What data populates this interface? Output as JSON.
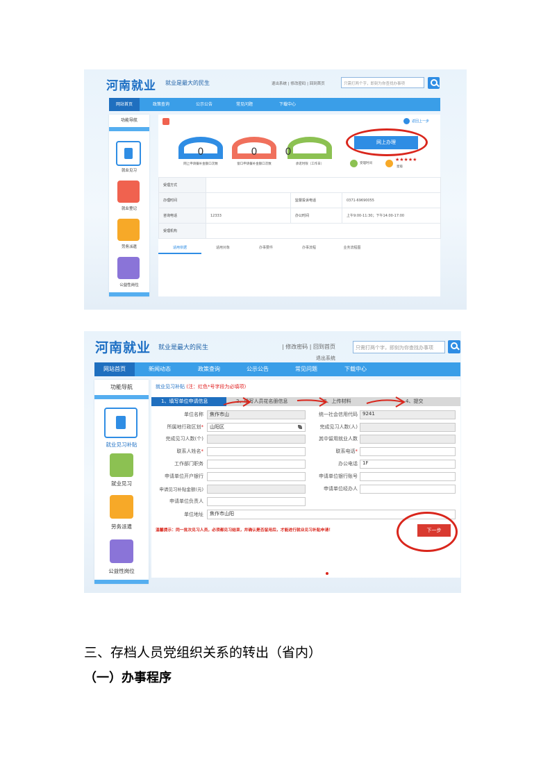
{
  "shot1": {
    "logo": "河南就业",
    "slogan": "就业是最大的民生",
    "top_links": "退出系统 | 修改密码 | 回到首页",
    "search_placeholder": "只需打两个字，即刻为你查找办事项",
    "nav": [
      "网站首页",
      "政策查询",
      "公示公告",
      "常见问题",
      "下载中心"
    ],
    "side_title": "功能导航",
    "side_items": [
      {
        "label": "就业见习",
        "color": "#2f8de4",
        "icon": "notebook-icon"
      },
      {
        "label": "就业登记",
        "color": "#f0624f",
        "icon": "calendar-icon"
      },
      {
        "label": "劳务派遣",
        "color": "#f7a928",
        "icon": "car-icon"
      },
      {
        "label": "公益性岗位",
        "color": "#8a74d8",
        "icon": "card-icon"
      }
    ],
    "back_link": "返回上一步",
    "gauges": [
      {
        "value": "0",
        "label": "网上申请餐补金额口次数",
        "color": "#2f8de4"
      },
      {
        "value": "0",
        "label": "窗口申请餐补金额口次数",
        "color": "#f0705c"
      },
      {
        "value": "0",
        "label": "承诺时限（工作日）",
        "color": "#8cc152"
      }
    ],
    "online_button": "网上办理",
    "rating_label": "星级",
    "time_label": "受理时间",
    "stars": "★★★★★",
    "info_rows": [
      {
        "label1": "受理方式",
        "value1": "",
        "label2": "",
        "value2": ""
      },
      {
        "label1": "办理时间",
        "value1": "",
        "label2": "监督投诉电话",
        "value2": "0371-69690055"
      },
      {
        "label1": "咨询电话",
        "value1": "12333",
        "label2": "办公时间",
        "value2": "上午9:00-11:30；下午14:00-17:00"
      },
      {
        "label1": "受理机构",
        "value1": "",
        "label2": "",
        "value2": ""
      }
    ],
    "tabs": [
      "适用依据",
      "适用对象",
      "办事要件",
      "办事流程",
      "业务流程图"
    ]
  },
  "shot2": {
    "logo": "河南就业",
    "slogan": "就业是最大的民生",
    "top_links": "| 修改密码 | 回到首页",
    "logout": "退出系统",
    "search_placeholder": "只需打两个字，即刻为你查找办事项",
    "nav": [
      "网站首页",
      "新闻动态",
      "政策查询",
      "公示公告",
      "常见问题",
      "下载中心"
    ],
    "side_title": "功能导航",
    "side_items": [
      {
        "label": "就业见习补贴",
        "color": "#2f8de4",
        "icon": "document-icon"
      },
      {
        "label": "就业见习",
        "color": "#8cc152",
        "icon": "notebook-icon"
      },
      {
        "label": "劳务派遣",
        "color": "#f7a928",
        "icon": "car-icon"
      },
      {
        "label": "公益性岗位",
        "color": "#8a74d8",
        "icon": "card-icon"
      }
    ],
    "breadcrumb": "就业见习补贴",
    "breadcrumb_note": "(注：红色*号字段为必填项)",
    "steps": [
      "1、填写单位申请信息",
      "2、填写人员花名册信息",
      "3、上传材料",
      "4、提交"
    ],
    "fields_left": [
      {
        "label": "单位名称",
        "value": "焦作市山",
        "req": false,
        "ro": true
      },
      {
        "label": "所属地行政区划",
        "value": "山阳区",
        "req": true,
        "ro": false
      },
      {
        "label": "完成见习人数(个)",
        "value": "",
        "req": false,
        "ro": true
      },
      {
        "label": "联系人姓名",
        "value": "",
        "req": true,
        "ro": false
      },
      {
        "label": "工作部门职务",
        "value": "",
        "req": false,
        "ro": false
      },
      {
        "label": "申请单位开户银行",
        "value": "",
        "req": false,
        "ro": false
      },
      {
        "label": "申请见习补贴金额(元)",
        "value": "",
        "req": false,
        "ro": true
      },
      {
        "label": "申请单位负责人",
        "value": "",
        "req": false,
        "ro": false
      }
    ],
    "fields_right": [
      {
        "label": "统一社会信用代码",
        "value": "9241",
        "req": false,
        "ro": true
      },
      {
        "label": "完成见习人数(人)",
        "value": "",
        "req": false,
        "ro": true
      },
      {
        "label": "其中留用就业人数",
        "value": "",
        "req": false,
        "ro": true
      },
      {
        "label": "联系电话",
        "value": "",
        "req": true,
        "ro": false
      },
      {
        "label": "办公电话",
        "value": "1F",
        "req": false,
        "ro": false
      },
      {
        "label": "申请单位银行账号",
        "value": "",
        "req": false,
        "ro": false
      },
      {
        "label": "申请单位经办人",
        "value": "",
        "req": false,
        "ro": false
      }
    ],
    "address_label": "单位地址",
    "address_value": "焦作市山阳",
    "tip": "温馨提示：同一批次见习人员，必须都见习结束，并确认是否留用后，才能进行就业见习补贴申请！",
    "next_button": "下一步"
  },
  "headings": {
    "section": "三、存档人员党组织关系的转出（省内）",
    "sub": "（一）办事程序"
  }
}
